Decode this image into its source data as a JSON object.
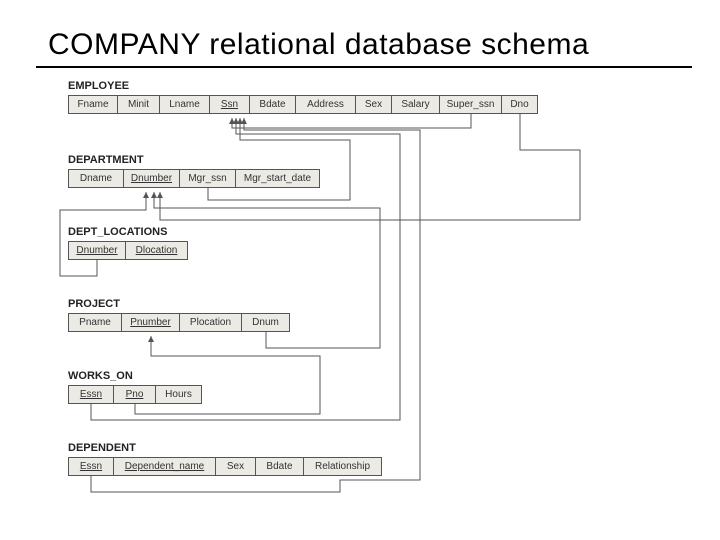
{
  "title": "COMPANY relational database schema",
  "tables": {
    "employee": {
      "name": "EMPLOYEE",
      "cols": [
        "Fname",
        "Minit",
        "Lname",
        "Ssn",
        "Bdate",
        "Address",
        "Sex",
        "Salary",
        "Super_ssn",
        "Dno"
      ]
    },
    "department": {
      "name": "DEPARTMENT",
      "cols": [
        "Dname",
        "Dnumber",
        "Mgr_ssn",
        "Mgr_start_date"
      ]
    },
    "dept_locations": {
      "name": "DEPT_LOCATIONS",
      "cols": [
        "Dnumber",
        "Dlocation"
      ]
    },
    "project": {
      "name": "PROJECT",
      "cols": [
        "Pname",
        "Pnumber",
        "Plocation",
        "Dnum"
      ]
    },
    "works_on": {
      "name": "WORKS_ON",
      "cols": [
        "Essn",
        "Pno",
        "Hours"
      ]
    },
    "dependent": {
      "name": "DEPENDENT",
      "cols": [
        "Essn",
        "Dependent_name",
        "Sex",
        "Bdate",
        "Relationship"
      ]
    }
  },
  "foreign_keys": [
    {
      "from": "EMPLOYEE.Super_ssn",
      "to": "EMPLOYEE.Ssn"
    },
    {
      "from": "EMPLOYEE.Dno",
      "to": "DEPARTMENT.Dnumber"
    },
    {
      "from": "DEPARTMENT.Mgr_ssn",
      "to": "EMPLOYEE.Ssn"
    },
    {
      "from": "DEPT_LOCATIONS.Dnumber",
      "to": "DEPARTMENT.Dnumber"
    },
    {
      "from": "PROJECT.Dnum",
      "to": "DEPARTMENT.Dnumber"
    },
    {
      "from": "WORKS_ON.Essn",
      "to": "EMPLOYEE.Ssn"
    },
    {
      "from": "WORKS_ON.Pno",
      "to": "PROJECT.Pnumber"
    },
    {
      "from": "DEPENDENT.Essn",
      "to": "EMPLOYEE.Ssn"
    }
  ]
}
